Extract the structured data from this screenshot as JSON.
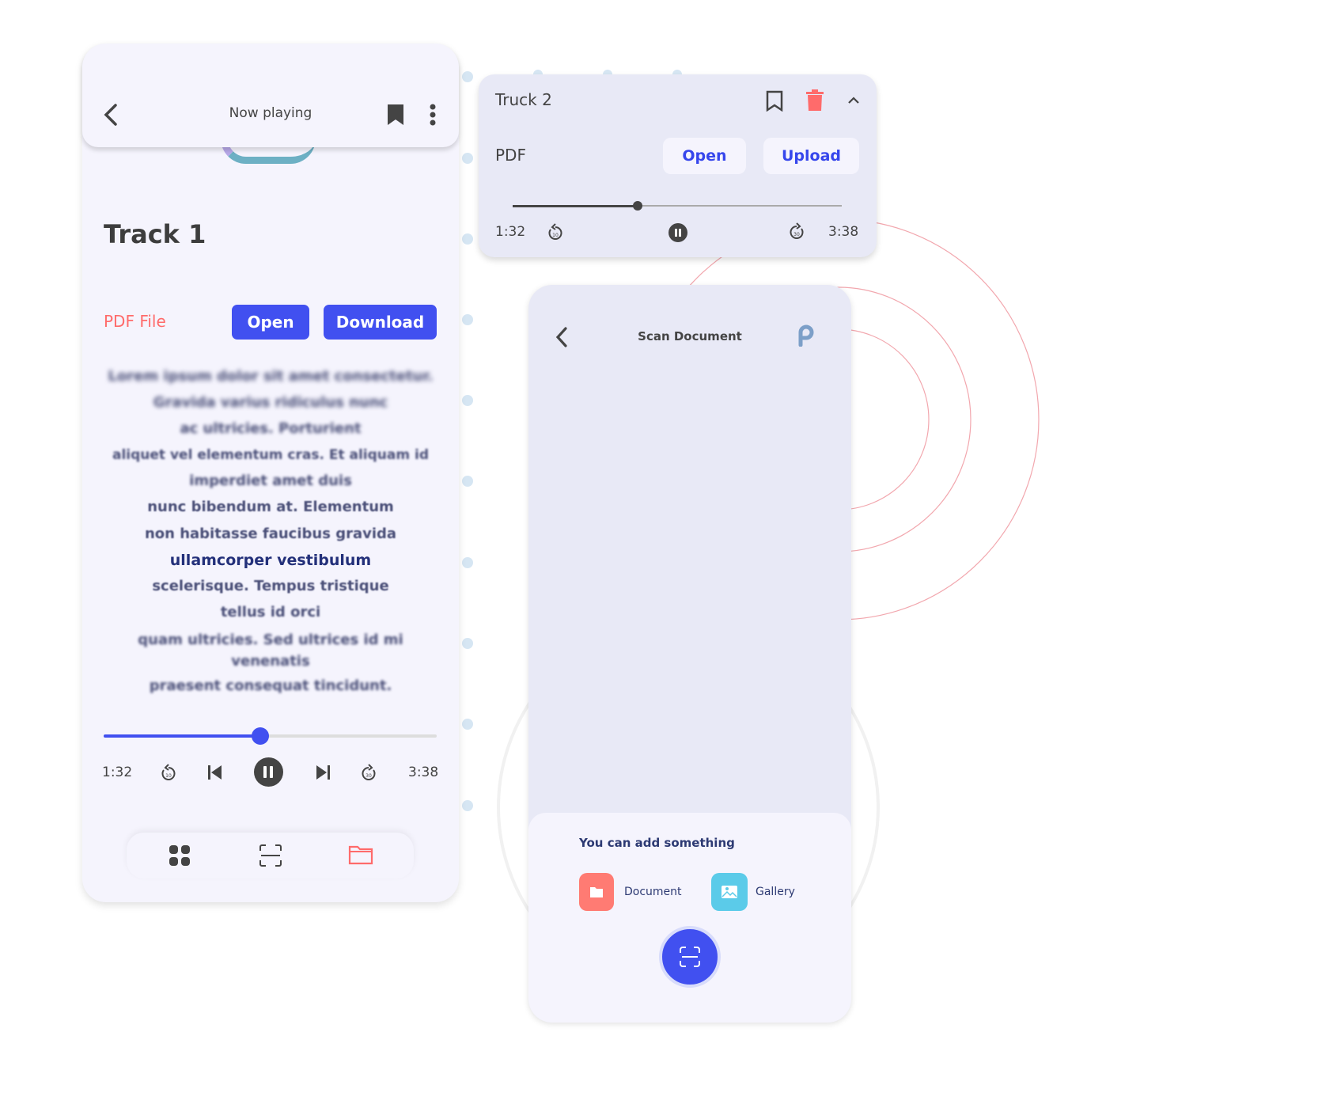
{
  "player": {
    "header_title": "Now playing",
    "track_title": "Track 1",
    "file_label": "PDF File",
    "open_label": "Open",
    "download_label": "Download",
    "lyrics": [
      "Lorem ipsum dolor sit amet consectetur.",
      "Gravida varius ridiculus nunc",
      "ac ultricies. Porturient",
      "aliquet vel elementum cras. Et aliquam id",
      "imperdiet amet duis",
      "nunc bibendum at. Elementum",
      "non habitasse faucibus gravida",
      "ullamcorper vestibulum",
      "scelerisque. Tempus tristique",
      "tellus id orci",
      "quam ultricies. Sed ultrices id mi venenatis",
      "praesent consequat tincidunt."
    ],
    "current_time": "1:32",
    "total_time": "3:38",
    "progress": 0.47,
    "rewind_seconds": "10",
    "forward_seconds": "30",
    "accent_color": "#4150f0",
    "file_color": "#ff6b6b"
  },
  "mini_player": {
    "title": "Truck 2",
    "file_label": "PDF",
    "open_label": "Open",
    "upload_label": "Upload",
    "current_time": "1:32",
    "total_time": "3:38",
    "progress": 0.38,
    "delete_color": "#ff6b6b"
  },
  "scan": {
    "title": "Scan Document",
    "sheet_title": "You can add something",
    "options": [
      {
        "label": "Document",
        "icon": "folder-icon",
        "color": "#ff7b73"
      },
      {
        "label": "Gallery",
        "icon": "image-icon",
        "color": "#5bcbe9"
      }
    ]
  }
}
